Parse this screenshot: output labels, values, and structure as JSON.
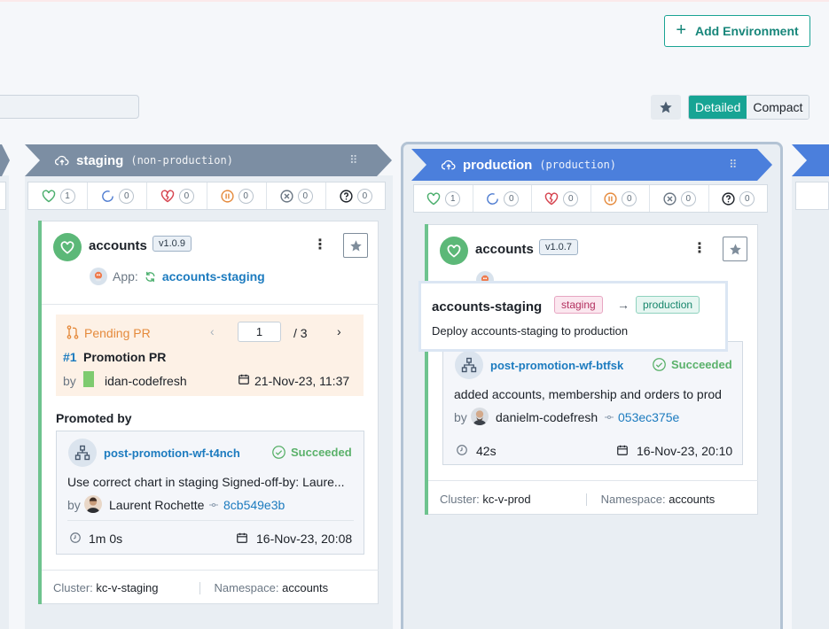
{
  "toolbar": {
    "add_environment": "Add Environment",
    "view_detailed": "Detailed",
    "view_compact": "Compact"
  },
  "staging": {
    "name": "staging",
    "kind": "(non-production)",
    "status_counts": [
      "1",
      "0",
      "0",
      "0",
      "0",
      "0"
    ],
    "card": {
      "app": "accounts",
      "version": "v1.0.9",
      "app_prefix": "App:",
      "app_link": "accounts-staging",
      "pr": {
        "label": "Pending PR",
        "page": "1",
        "total": "/ 3",
        "number": "#1",
        "title": "Promotion PR",
        "by": "by",
        "author": "idan-codefresh",
        "date": "21-Nov-23, 11:37"
      },
      "promoted_by": "Promoted by",
      "workflow": {
        "name": "post-promotion-wf-t4nch",
        "status": "Succeeded",
        "message": "Use correct chart in staging Signed-off-by: Laure...",
        "by": "by",
        "author": "Laurent Rochette",
        "sha": "8cb549e3b",
        "duration": "1m 0s",
        "date": "16-Nov-23, 20:08"
      },
      "cluster_label": "Cluster:",
      "cluster": "kc-v-staging",
      "namespace_label": "Namespace:",
      "namespace": "accounts"
    }
  },
  "production": {
    "name": "production",
    "kind": "(production)",
    "status_counts": [
      "1",
      "0",
      "0",
      "0",
      "0",
      "0"
    ],
    "card": {
      "app": "accounts",
      "version": "v1.0.7",
      "workflow": {
        "name": "post-promotion-wf-btfsk",
        "status": "Succeeded",
        "message": "added accounts, membership and orders to prod",
        "by": "by",
        "author": "danielm-codefresh",
        "sha": "053ec375e",
        "duration": "42s",
        "date": "16-Nov-23, 20:10"
      },
      "cluster_label": "Cluster:",
      "cluster": "kc-v-prod",
      "namespace_label": "Namespace:",
      "namespace": "accounts"
    }
  },
  "tooltip": {
    "title": "accounts-staging",
    "from": "staging",
    "arrow": "→",
    "to": "production",
    "description": "Deploy accounts-staging to production"
  },
  "colors": {
    "accent": "#17a494",
    "staging_header": "#7c8ea3",
    "production_header": "#4b7fdc",
    "healthy": "#5cb878"
  },
  "icons": [
    "plus-icon",
    "star-icon",
    "cloud-upload-icon",
    "drag-handle-icon",
    "heart-icon",
    "progressing-icon",
    "broken-heart-icon",
    "paused-icon",
    "missing-icon",
    "unknown-icon",
    "kebab-icon",
    "sync-icon",
    "pull-request-icon",
    "calendar-icon",
    "workflow-icon",
    "check-circle-icon",
    "commit-icon",
    "clock-icon"
  ]
}
